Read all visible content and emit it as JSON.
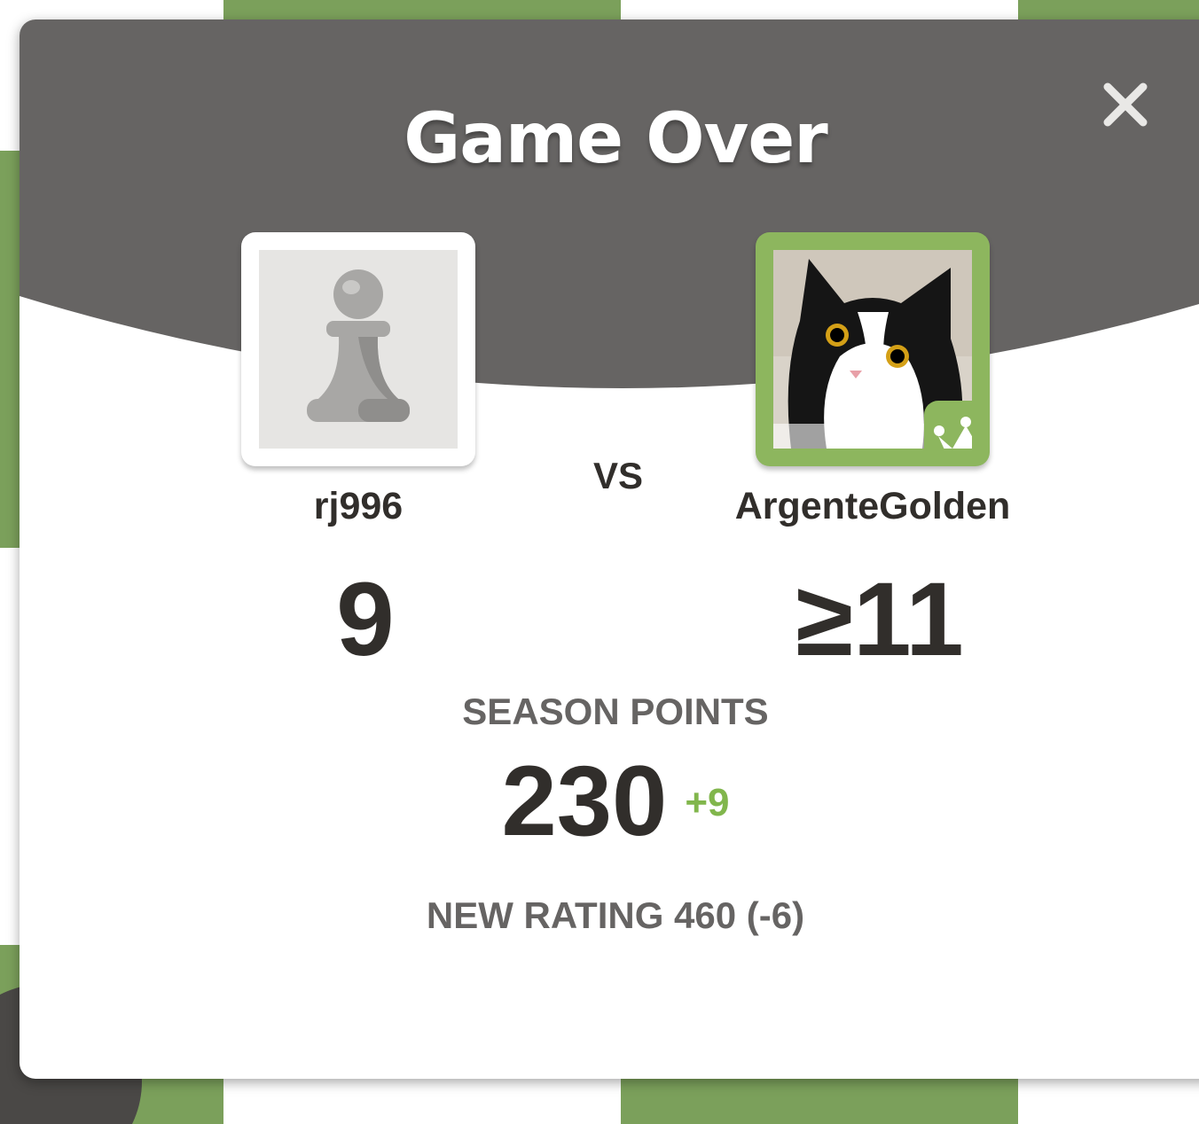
{
  "colors": {
    "header_gray": "#666463",
    "accent_green": "#81b64c",
    "frame_green": "#8db65e",
    "board_light": "#ebecd0",
    "board_dark": "#739552",
    "text_dark": "#312e2b"
  },
  "modal": {
    "title": "Game Over",
    "close_icon": "close-icon"
  },
  "players": {
    "left": {
      "username": "rj996",
      "score": "9",
      "avatar_icon": "pawn-icon"
    },
    "right": {
      "username": "ArgenteGolden",
      "score": "≥11",
      "avatar_icon": "cat-avatar-icon",
      "badge_icon": "crown-icon"
    },
    "versus_label": "VS"
  },
  "season": {
    "label": "SEASON POINTS",
    "points": "230",
    "delta": "+9"
  },
  "rating": {
    "text": "NEW RATING 460 (-6)"
  }
}
